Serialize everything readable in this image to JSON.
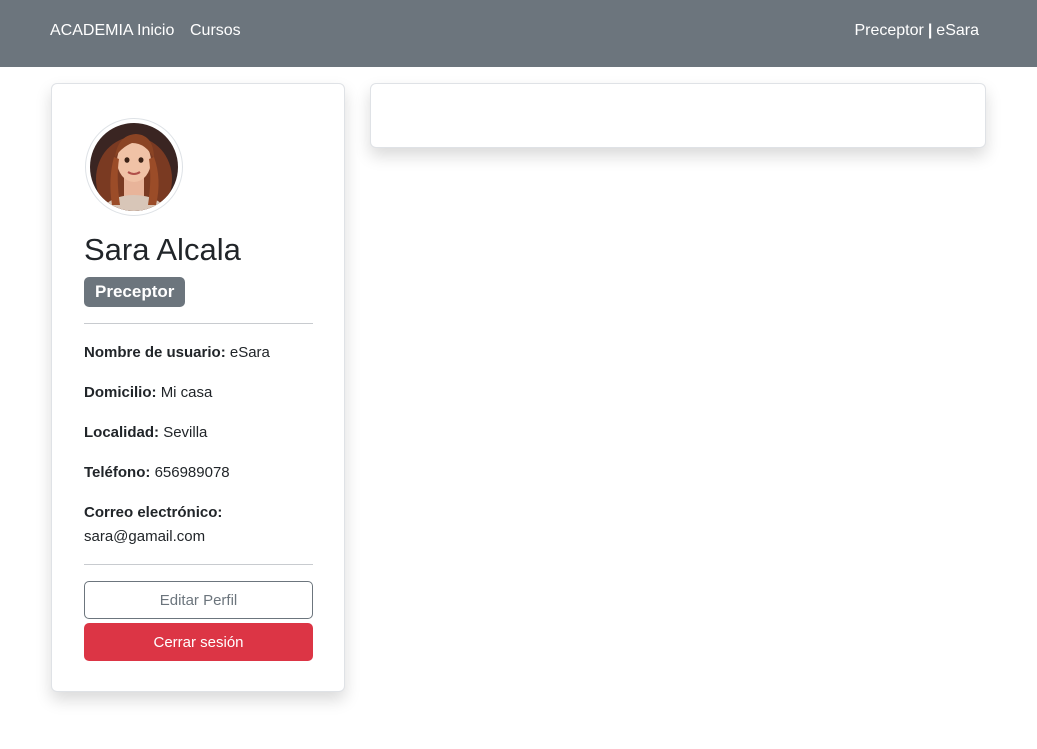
{
  "navbar": {
    "brand": "ACADEMIA",
    "links": [
      "Inicio",
      "Cursos"
    ],
    "user_role": "Preceptor",
    "separator": "|",
    "username": "eSara"
  },
  "profile": {
    "avatar_alt": "avatar",
    "name": "Sara Alcala",
    "role_badge": "Preceptor",
    "fields": [
      {
        "label": "Nombre de usuario:",
        "value": "eSara"
      },
      {
        "label": "Domicilio:",
        "value": "Mi casa"
      },
      {
        "label": "Localidad:",
        "value": "Sevilla"
      },
      {
        "label": "Teléfono:",
        "value": "656989078"
      },
      {
        "label": "Correo electrónico:",
        "value": "sara@gamail.com"
      }
    ],
    "edit_button": "Editar Perfil",
    "logout_button": "Cerrar sesión"
  },
  "colors": {
    "navbar_bg": "#6c757d",
    "badge_bg": "#6c757d",
    "danger": "#dc3545"
  }
}
